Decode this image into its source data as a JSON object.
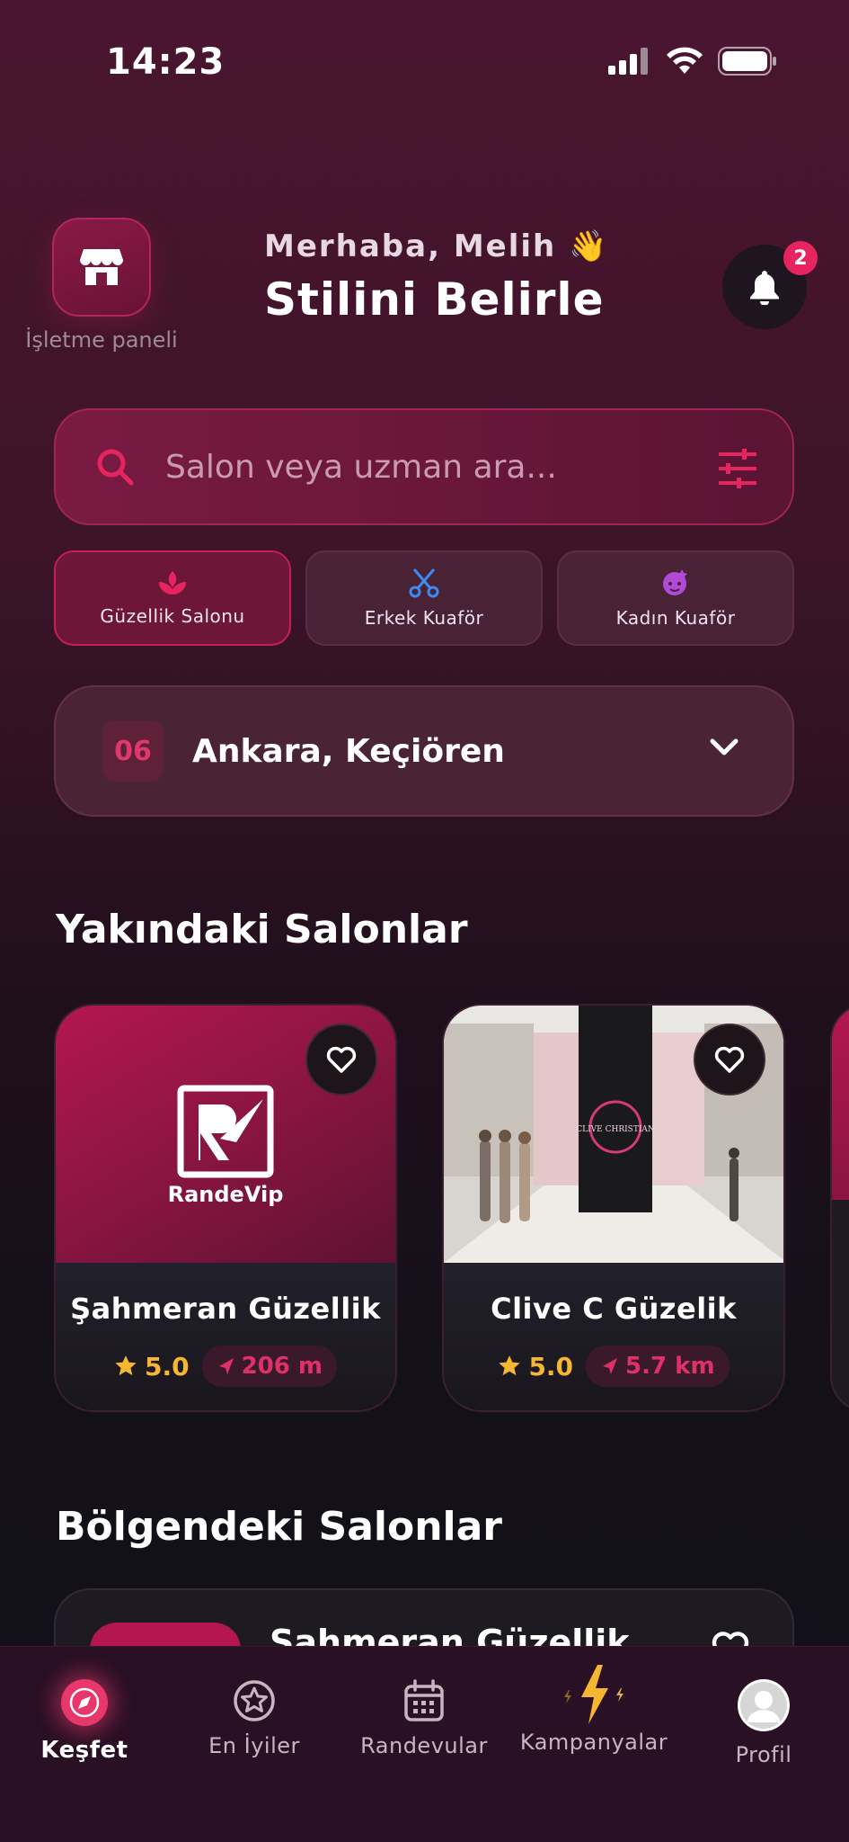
{
  "status_bar": {
    "time": "14:23"
  },
  "header": {
    "business_label": "İşletme paneli",
    "greeting": "Merhaba, Melih 👋",
    "headline": "Stilini Belirle",
    "notification_count": "2"
  },
  "search": {
    "placeholder": "Salon veya uzman ara..."
  },
  "categories": [
    {
      "label": "Güzellik Salonu",
      "icon": "lotus-icon",
      "color": "#e6245f",
      "active": true
    },
    {
      "label": "Erkek Kuaför",
      "icon": "scissors-icon",
      "color": "#3d8bf0",
      "active": false
    },
    {
      "label": "Kadın Kuaför",
      "icon": "face-icon",
      "color": "#b14ad8",
      "active": false
    }
  ],
  "location": {
    "code": "06",
    "name": "Ankara, Keçiören"
  },
  "nearby": {
    "title": "Yakındaki Salonlar",
    "salons": [
      {
        "name": "Şahmeran Güzellik",
        "rating": "5.0",
        "distance": "206 m",
        "brand_text": "RandeVip"
      },
      {
        "name": "Clive C Güzelik",
        "rating": "5.0",
        "distance": "5.7 km",
        "sign_text": "CLIVE CHRISTIAN"
      }
    ]
  },
  "region": {
    "title": "Bölgendeki Salonlar",
    "first_item": {
      "name": "Şahmeran Güzellik"
    }
  },
  "tabbar": [
    {
      "label": "Keşfet",
      "icon": "compass-icon",
      "active": true
    },
    {
      "label": "En İyiler",
      "icon": "star-badge-icon",
      "active": false
    },
    {
      "label": "Randevular",
      "icon": "calendar-icon",
      "active": false
    },
    {
      "label": "Kampanyalar",
      "icon": "lightning-icon",
      "active": false
    },
    {
      "label": "Profil",
      "icon": "avatar-icon",
      "active": false
    }
  ],
  "colors": {
    "accent": "#e6245f",
    "star": "#f5b731",
    "background": "#3d1429"
  }
}
